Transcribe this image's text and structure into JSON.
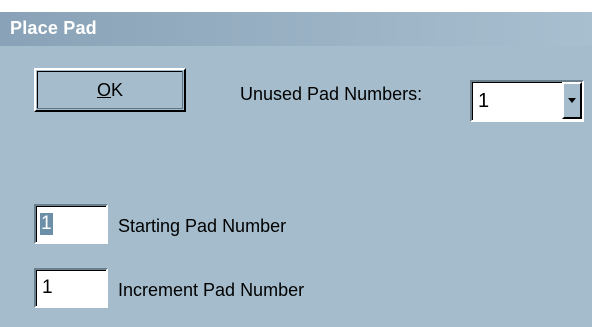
{
  "window": {
    "title": "Place Pad"
  },
  "ok_button": {
    "mnemonic": "O",
    "rest": "K"
  },
  "unused_pad_numbers": {
    "label": "Unused Pad Numbers:",
    "selected_value": "1"
  },
  "starting_pad": {
    "value": "1",
    "label": "Starting Pad Number"
  },
  "increment_pad": {
    "value": "1",
    "label": "Increment Pad Number"
  },
  "icons": {
    "dropdown": "chevron-down-icon"
  },
  "colors": {
    "dialog_bg": "#a4bccb",
    "titlebar_start": "#8aa2b7",
    "titlebar_end": "#a7bfcf",
    "selection": "#6c8fa8"
  }
}
